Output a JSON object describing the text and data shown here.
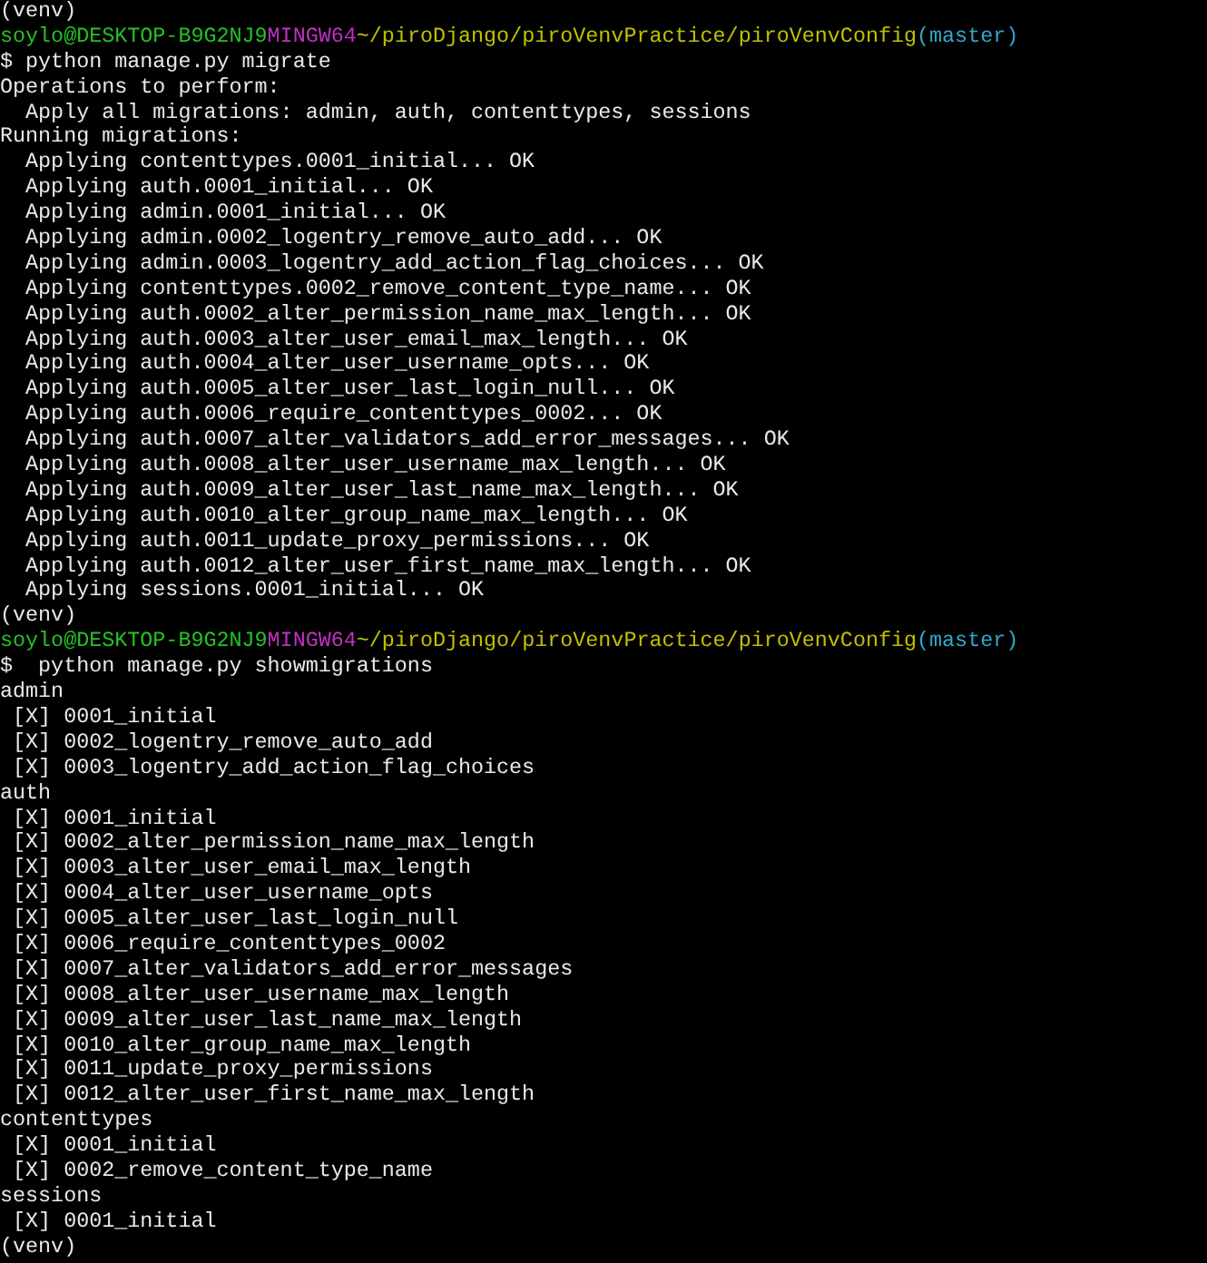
{
  "terminal": {
    "lines": [
      {
        "kind": "output",
        "text": "(venv)"
      },
      {
        "kind": "prompt",
        "user": "soylo@DESKTOP-B9G2NJ9",
        "shell": "MINGW64",
        "path": "~/piroDjango/piroVenvPractice/piroVenvConfig",
        "branch": "(master)"
      },
      {
        "kind": "output",
        "text": "$ python manage.py migrate"
      },
      {
        "kind": "output",
        "text": "Operations to perform:"
      },
      {
        "kind": "output",
        "text": "  Apply all migrations: admin, auth, contenttypes, sessions"
      },
      {
        "kind": "output",
        "text": "Running migrations:"
      },
      {
        "kind": "output",
        "text": "  Applying contenttypes.0001_initial... OK"
      },
      {
        "kind": "output",
        "text": "  Applying auth.0001_initial... OK"
      },
      {
        "kind": "output",
        "text": "  Applying admin.0001_initial... OK"
      },
      {
        "kind": "output",
        "text": "  Applying admin.0002_logentry_remove_auto_add... OK"
      },
      {
        "kind": "output",
        "text": "  Applying admin.0003_logentry_add_action_flag_choices... OK"
      },
      {
        "kind": "output",
        "text": "  Applying contenttypes.0002_remove_content_type_name... OK"
      },
      {
        "kind": "output",
        "text": "  Applying auth.0002_alter_permission_name_max_length... OK"
      },
      {
        "kind": "output",
        "text": "  Applying auth.0003_alter_user_email_max_length... OK"
      },
      {
        "kind": "output",
        "text": "  Applying auth.0004_alter_user_username_opts... OK"
      },
      {
        "kind": "output",
        "text": "  Applying auth.0005_alter_user_last_login_null... OK"
      },
      {
        "kind": "output",
        "text": "  Applying auth.0006_require_contenttypes_0002... OK"
      },
      {
        "kind": "output",
        "text": "  Applying auth.0007_alter_validators_add_error_messages... OK"
      },
      {
        "kind": "output",
        "text": "  Applying auth.0008_alter_user_username_max_length... OK"
      },
      {
        "kind": "output",
        "text": "  Applying auth.0009_alter_user_last_name_max_length... OK"
      },
      {
        "kind": "output",
        "text": "  Applying auth.0010_alter_group_name_max_length... OK"
      },
      {
        "kind": "output",
        "text": "  Applying auth.0011_update_proxy_permissions... OK"
      },
      {
        "kind": "output",
        "text": "  Applying auth.0012_alter_user_first_name_max_length... OK"
      },
      {
        "kind": "output",
        "text": "  Applying sessions.0001_initial... OK"
      },
      {
        "kind": "output",
        "text": "(venv)"
      },
      {
        "kind": "prompt",
        "user": "soylo@DESKTOP-B9G2NJ9",
        "shell": "MINGW64",
        "path": "~/piroDjango/piroVenvPractice/piroVenvConfig",
        "branch": "(master)"
      },
      {
        "kind": "output",
        "text": "$  python manage.py showmigrations"
      },
      {
        "kind": "output",
        "text": "admin"
      },
      {
        "kind": "output",
        "text": " [X] 0001_initial"
      },
      {
        "kind": "output",
        "text": " [X] 0002_logentry_remove_auto_add"
      },
      {
        "kind": "output",
        "text": " [X] 0003_logentry_add_action_flag_choices"
      },
      {
        "kind": "output",
        "text": "auth"
      },
      {
        "kind": "output",
        "text": " [X] 0001_initial"
      },
      {
        "kind": "output",
        "text": " [X] 0002_alter_permission_name_max_length"
      },
      {
        "kind": "output",
        "text": " [X] 0003_alter_user_email_max_length"
      },
      {
        "kind": "output",
        "text": " [X] 0004_alter_user_username_opts"
      },
      {
        "kind": "output",
        "text": " [X] 0005_alter_user_last_login_null"
      },
      {
        "kind": "output",
        "text": " [X] 0006_require_contenttypes_0002"
      },
      {
        "kind": "output",
        "text": " [X] 0007_alter_validators_add_error_messages"
      },
      {
        "kind": "output",
        "text": " [X] 0008_alter_user_username_max_length"
      },
      {
        "kind": "output",
        "text": " [X] 0009_alter_user_last_name_max_length"
      },
      {
        "kind": "output",
        "text": " [X] 0010_alter_group_name_max_length"
      },
      {
        "kind": "output",
        "text": " [X] 0011_update_proxy_permissions"
      },
      {
        "kind": "output",
        "text": " [X] 0012_alter_user_first_name_max_length"
      },
      {
        "kind": "output",
        "text": "contenttypes"
      },
      {
        "kind": "output",
        "text": " [X] 0001_initial"
      },
      {
        "kind": "output",
        "text": " [X] 0002_remove_content_type_name"
      },
      {
        "kind": "output",
        "text": "sessions"
      },
      {
        "kind": "output",
        "text": " [X] 0001_initial"
      },
      {
        "kind": "output",
        "text": "(venv)"
      }
    ]
  }
}
